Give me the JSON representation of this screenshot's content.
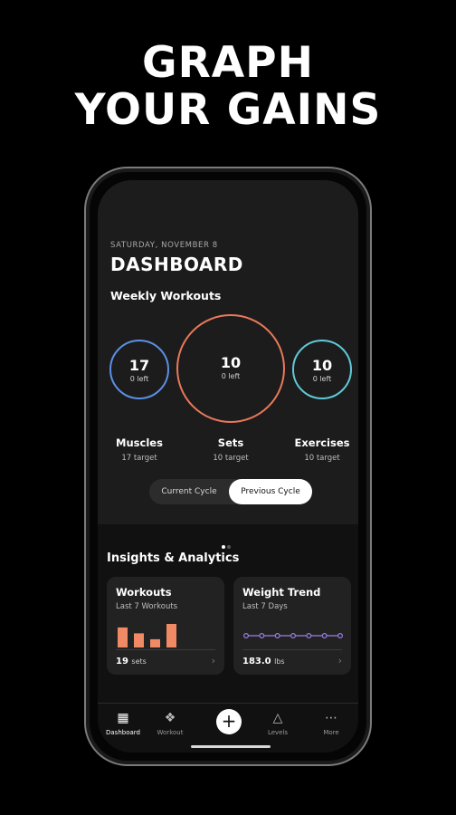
{
  "headline": {
    "line1": "GRAPH",
    "line2": "YOUR GAINS"
  },
  "dashboard": {
    "date": "SATURDAY, NOVEMBER 8",
    "title": "DASHBOARD",
    "weekly_label": "Weekly Workouts",
    "rings": [
      {
        "value": "17",
        "sub": "0 left",
        "color": "#5b8fe6"
      },
      {
        "value": "10",
        "sub": "0 left",
        "color": "#e9795a"
      },
      {
        "value": "10",
        "sub": "0 left",
        "color": "#5fc9d6"
      }
    ],
    "stats": [
      {
        "label": "Muscles",
        "target": "17 target"
      },
      {
        "label": "Sets",
        "target": "10 target"
      },
      {
        "label": "Exercises",
        "target": "10 target"
      }
    ],
    "toggle": {
      "current": "Current Cycle",
      "previous": "Previous Cycle",
      "selected": "Previous Cycle"
    },
    "page_dots": {
      "count": 2,
      "active": 0
    }
  },
  "insights": {
    "title": "Insights & Analytics",
    "cards": [
      {
        "title": "Workouts",
        "subtitle": "Last 7 Workouts",
        "value": "19",
        "unit": "sets",
        "bars": [
          0.85,
          0.6,
          0.35,
          1.0
        ],
        "bar_color": "#f08a65"
      },
      {
        "title": "Weight Trend",
        "subtitle": "Last 7 Days",
        "value": "183.0",
        "unit": "lbs",
        "points": [
          183.0,
          183.0,
          183.0,
          183.0,
          183.0,
          183.0,
          183.0
        ],
        "line_color": "#9b7fe6"
      }
    ]
  },
  "nav": {
    "items": [
      {
        "label": "Dashboard",
        "icon": "dashboard-icon",
        "active": true
      },
      {
        "label": "Workout",
        "icon": "dumbbell-icon",
        "active": false
      },
      {
        "label": "Levels",
        "icon": "levels-icon",
        "active": false
      },
      {
        "label": "More",
        "icon": "more-icon",
        "active": false
      }
    ],
    "fab_icon": "plus-icon"
  },
  "colors": {
    "background": "#000000",
    "accent_orange": "#e9795a",
    "accent_blue": "#5b8fe6",
    "accent_teal": "#5fc9d6"
  }
}
